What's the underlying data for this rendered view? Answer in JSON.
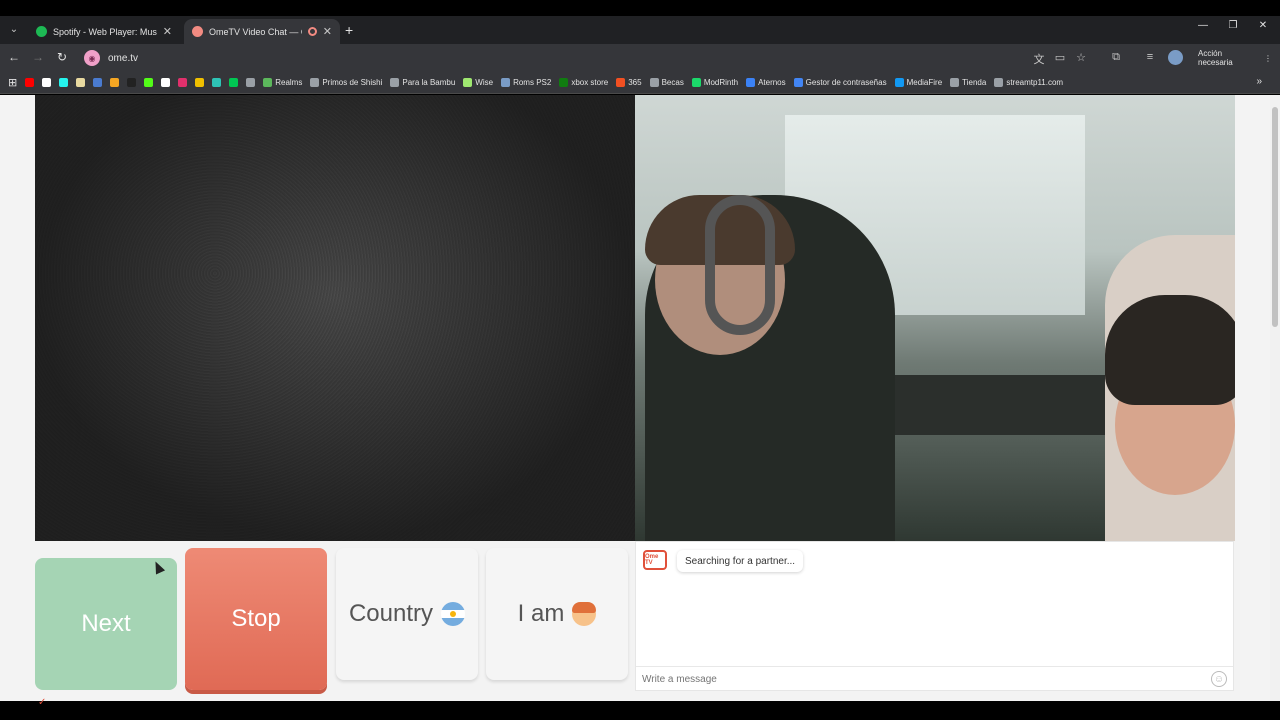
{
  "browser": {
    "tabs": [
      {
        "title": "Spotify - Web Player: Music for",
        "favicon_color": "#1db954",
        "active": false
      },
      {
        "title": "OmeTV Video Chat — Ome",
        "favicon_color": "#f28b82",
        "active": true
      }
    ],
    "url": "ome.tv",
    "action_label": "Acción necesaria",
    "window_controls": {
      "minimize": "—",
      "restore": "❐",
      "close": "✕"
    },
    "bookmarks": [
      {
        "label": "",
        "color": "#ff0000"
      },
      {
        "label": "",
        "color": "#ffffff"
      },
      {
        "label": "",
        "color": "#25f4ee"
      },
      {
        "label": "",
        "color": "#e8d9a0"
      },
      {
        "label": "",
        "color": "#4a7bd0"
      },
      {
        "label": "",
        "color": "#f5a623"
      },
      {
        "label": "",
        "color": "#222222"
      },
      {
        "label": "",
        "color": "#53fc18"
      },
      {
        "label": "",
        "color": "#ffffff"
      },
      {
        "label": "",
        "color": "#e1306c"
      },
      {
        "label": "",
        "color": "#f0c000"
      },
      {
        "label": "",
        "color": "#2ec4b6"
      },
      {
        "label": "",
        "color": "#00c853"
      },
      {
        "label": "",
        "color": "#9aa0a6"
      },
      {
        "label": "Realms",
        "color": "#5cb85c"
      },
      {
        "label": "Primos de Shishi",
        "color": "#9aa0a6"
      },
      {
        "label": "Para la Bambu",
        "color": "#9aa0a6"
      },
      {
        "label": "Wise",
        "color": "#9fe870"
      },
      {
        "label": "Roms PS2",
        "color": "#7a9cc6"
      },
      {
        "label": "xbox store",
        "color": "#107c10"
      },
      {
        "label": "365",
        "color": "#f25022"
      },
      {
        "label": "Becas",
        "color": "#9aa0a6"
      },
      {
        "label": "ModRinth",
        "color": "#1bd96a"
      },
      {
        "label": "Aternos",
        "color": "#3b82f6"
      },
      {
        "label": "Gestor de contraseñas",
        "color": "#4285f4"
      },
      {
        "label": "MediaFire",
        "color": "#1299f3"
      },
      {
        "label": "Tienda",
        "color": "#9aa0a6"
      },
      {
        "label": "streamtp11.com",
        "color": "#9aa0a6"
      }
    ]
  },
  "ometv": {
    "buttons": {
      "next": "Next",
      "stop": "Stop",
      "country": "Country",
      "iam": "I am"
    },
    "chat": {
      "logo": "Ome TV",
      "status": "Searching for a partner...",
      "input_placeholder": "Write a message"
    }
  },
  "colors": {
    "next": "#a5d4b4",
    "stop": "#e06a55",
    "brand": "#e0503a"
  }
}
